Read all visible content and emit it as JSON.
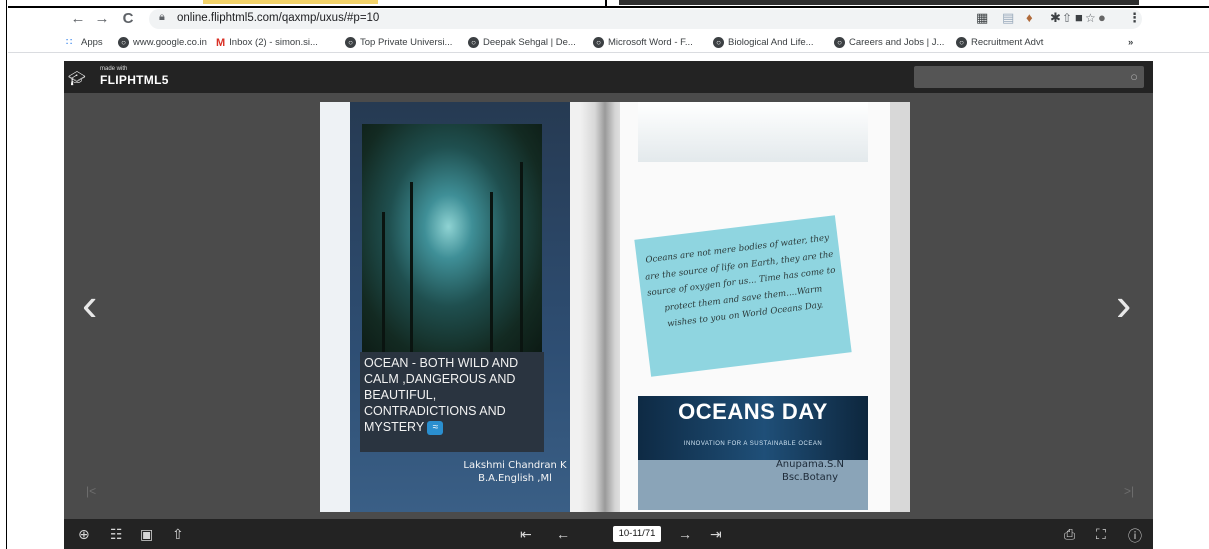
{
  "browser": {
    "url": "online.fliphtml5.com/qaxmp/uxus/#p=10",
    "nav": {
      "back": "←",
      "forward": "→",
      "reload": "C"
    }
  },
  "bookmarks": [
    {
      "label": "Apps",
      "icon": "apps-grid-icon"
    },
    {
      "label": "www.google.co.in",
      "icon": "globe-icon"
    },
    {
      "label": "Inbox (2) - simon.si...",
      "icon": "gmail-icon"
    },
    {
      "label": "Top Private Universi...",
      "icon": "globe-icon"
    },
    {
      "label": "Deepak Sehgal | De...",
      "icon": "globe-icon"
    },
    {
      "label": "Microsoft Word - F...",
      "icon": "globe-icon"
    },
    {
      "label": "Biological And Life...",
      "icon": "globe-icon"
    },
    {
      "label": "Careers and Jobs | J...",
      "icon": "globe-icon"
    },
    {
      "label": "Recruitment Advt",
      "icon": "globe-icon"
    },
    {
      "label": "»",
      "icon": ""
    }
  ],
  "viewer": {
    "logo_made": "made with",
    "logo_brand": "FLIPHTML5",
    "left_page": {
      "caption": "OCEAN - BOTH WILD AND CALM ,DANGEROUS AND BEAUTIFUL, CONTRADICTIONS AND MYSTERY",
      "author_name": "Lakshmi Chandran K",
      "author_course": "B.A.English ,Ml"
    },
    "right_page": {
      "quote": "Oceans are not mere bodies of water, they are the source of life on Earth, they are the source of oxygen for us... Time has come to protect them and save them....Warm wishes to you on World Oceans Day.",
      "banner_title": "OCEANS DAY",
      "banner_subtitle": "INNOVATION FOR A SUSTAINABLE OCEAN",
      "author_name": "Anupama.S.N",
      "author_course": "Bsc.Botany"
    },
    "page_indicator": "10-11/71"
  }
}
